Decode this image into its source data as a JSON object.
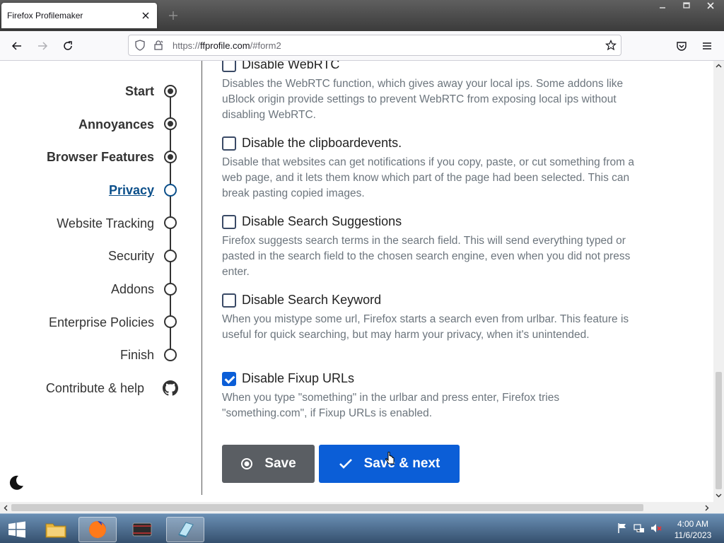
{
  "window": {
    "tab_title": "Firefox Profilemaker"
  },
  "navbar": {
    "url_prefix": "https://",
    "url_host": "ffprofile.com",
    "url_path": "/#form2"
  },
  "sidebar": {
    "steps": [
      {
        "label": "Start",
        "state": "done"
      },
      {
        "label": "Annoyances",
        "state": "done"
      },
      {
        "label": "Browser Features",
        "state": "done"
      },
      {
        "label": "Privacy",
        "state": "active"
      },
      {
        "label": "Website Tracking",
        "state": "todo"
      },
      {
        "label": "Security",
        "state": "todo"
      },
      {
        "label": "Addons",
        "state": "todo"
      },
      {
        "label": "Enterprise Policies",
        "state": "todo"
      },
      {
        "label": "Finish",
        "state": "todo"
      }
    ],
    "contribute_label": "Contribute & help"
  },
  "options": [
    {
      "label": "Disable WebRTC",
      "checked": false,
      "description": "Disables the WebRTC function, which gives away your local ips. Some addons like uBlock origin provide settings to prevent WebRTC from exposing local ips without disabling WebRTC."
    },
    {
      "label": "Disable the clipboardevents.",
      "checked": false,
      "description": "Disable that websites can get notifications if you copy, paste, or cut something from a web page, and it lets them know which part of the page had been selected. This can break pasting copied images."
    },
    {
      "label": "Disable Search Suggestions",
      "checked": false,
      "description": "Firefox suggests search terms in the search field. This will send everything typed or pasted in the search field to the chosen search engine, even when you did not press enter."
    },
    {
      "label": "Disable Search Keyword",
      "checked": false,
      "description": "When you mistype some url, Firefox starts a search even from urlbar. This feature is useful for quick searching, but may harm your privacy, when it's unintended."
    },
    {
      "label": "Disable Fixup URLs",
      "checked": true,
      "description": "When you type \"something\" in the urlbar and press enter, Firefox tries \"something.com\", if Fixup URLs is enabled."
    }
  ],
  "buttons": {
    "save": "Save",
    "save_next": "Save & next"
  },
  "taskbar": {
    "time": "4:00 AM",
    "date": "11/6/2023"
  },
  "colors": {
    "accent": "#0b5ed7",
    "active_step": "#0b4f8a",
    "save_button": "#5a5e63"
  }
}
